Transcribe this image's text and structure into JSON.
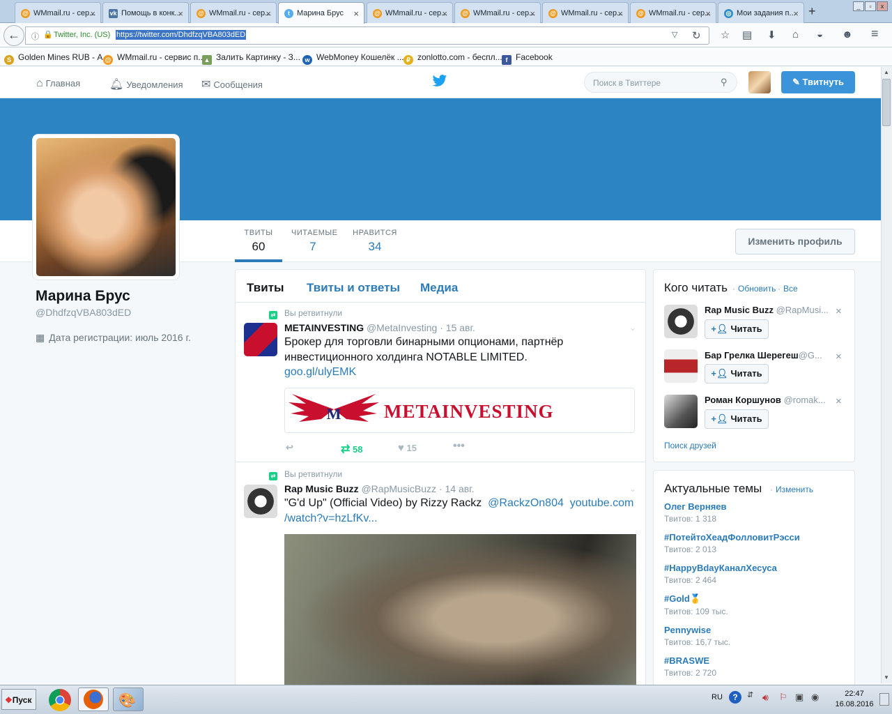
{
  "browser": {
    "tabs": [
      {
        "label": "WMmail.ru - сер...",
        "icon": "wmmail-icon"
      },
      {
        "label": "Помощь в конк...",
        "icon": "vk-icon"
      },
      {
        "label": "WMmail.ru - сер...",
        "icon": "wmmail-icon"
      },
      {
        "label": "Марина Брус",
        "icon": "twitter-icon",
        "active": true
      },
      {
        "label": "WMmail.ru - сер...",
        "icon": "wmmail-icon"
      },
      {
        "label": "WMmail.ru - сер...",
        "icon": "wmmail-icon"
      },
      {
        "label": "WMmail.ru - сер...",
        "icon": "wmmail-icon"
      },
      {
        "label": "WMmail.ru - сер...",
        "icon": "wmmail-icon"
      },
      {
        "label": "Мои задания п...",
        "icon": "globe-icon"
      }
    ],
    "site_identity": "Twitter, Inc. (US)",
    "url": "https://twitter.com/DhdfzqVBA803dED",
    "bookmarks": [
      {
        "label": "Golden Mines RUB - А...",
        "icon": "goldenmines-icon"
      },
      {
        "label": "WMmail.ru - сервис п...",
        "icon": "wmmail-icon"
      },
      {
        "label": "Залить Картинку - З...",
        "icon": "image-icon"
      },
      {
        "label": "WebMoney Кошелёк ...",
        "icon": "webmoney-icon"
      },
      {
        "label": "zonlotto.com - беспл...",
        "icon": "zonlotto-icon"
      },
      {
        "label": "Facebook",
        "icon": "facebook-icon"
      }
    ]
  },
  "twitter_nav": {
    "home": "Главная",
    "notifications": "Уведомления",
    "messages": "Сообщения",
    "search_placeholder": "Поиск в Твиттере",
    "tweet_button": "Твитнуть"
  },
  "profile": {
    "name": "Марина Брус",
    "handle": "@DhdfzqVBA803dED",
    "joined": "Дата регистрации: июль 2016 г.",
    "stats": [
      {
        "label": "ТВИТЫ",
        "value": "60"
      },
      {
        "label": "ЧИТАЕМЫЕ",
        "value": "7"
      },
      {
        "label": "НРАВИТСЯ",
        "value": "34"
      }
    ],
    "edit_button": "Изменить профиль"
  },
  "timeline": {
    "tabs": [
      "Твиты",
      "Твиты и ответы",
      "Медиа"
    ],
    "tweets": [
      {
        "retweet_note": "Вы ретвитнули",
        "author": "METAINVESTING",
        "handle": "@MetaInvesting",
        "date": "15 авг.",
        "text": "Брокер для торговли бинарными опционами, партнёр инвестиционного холдинга NOTABLE LIMITED.",
        "link": "goo.gl/ulyEMK",
        "card_text": "METAINVESTING",
        "retweets": "58",
        "likes": "15"
      },
      {
        "retweet_note": "Вы ретвитнули",
        "author": "Rap Music Buzz",
        "handle": "@RapMusicBuzz",
        "date": "14 авг.",
        "text": "\"G'd Up\" (Official Video) by Rizzy Rackz",
        "mention": "@RackzOn804",
        "link1": "youtube.com",
        "link2": "/watch?v=hzLfKv..."
      }
    ]
  },
  "who_to_follow": {
    "title": "Кого читать",
    "refresh": "Обновить",
    "all": "Все",
    "dot": "·",
    "follow_label": "Читать",
    "users": [
      {
        "name": "Rap Music Buzz",
        "handle": "@RapMusi..."
      },
      {
        "name": "Бар Грелка Шерегеш",
        "handle": "@G..."
      },
      {
        "name": "Роман Коршунов",
        "handle": "@romak..."
      }
    ],
    "find_friends": "Поиск друзей"
  },
  "trends": {
    "title": "Актуальные темы",
    "change": "Изменить",
    "items": [
      {
        "name": "Олег Верняев",
        "count": "Твитов: 1 318"
      },
      {
        "name": "#ПотейтоХеадФолловитРэсси",
        "count": "Твитов: 2 013"
      },
      {
        "name": "#HappyBdayКаналХесуса",
        "count": "Твитов: 2 464"
      },
      {
        "name": "#Gold🥇",
        "count": "Твитов: 109 тыс."
      },
      {
        "name": "Pennywise",
        "count": "Твитов: 16,7 тыс."
      },
      {
        "name": "#BRASWE",
        "count": "Твитов: 2 720"
      }
    ]
  },
  "taskbar": {
    "start": "Пуск",
    "lang": "RU",
    "time": "22:47",
    "date": "16.08.2016"
  },
  "colors": {
    "twitter_blue": "#2b7bb9",
    "banner": "#2c84c3",
    "retweet_green": "#19cf86"
  }
}
